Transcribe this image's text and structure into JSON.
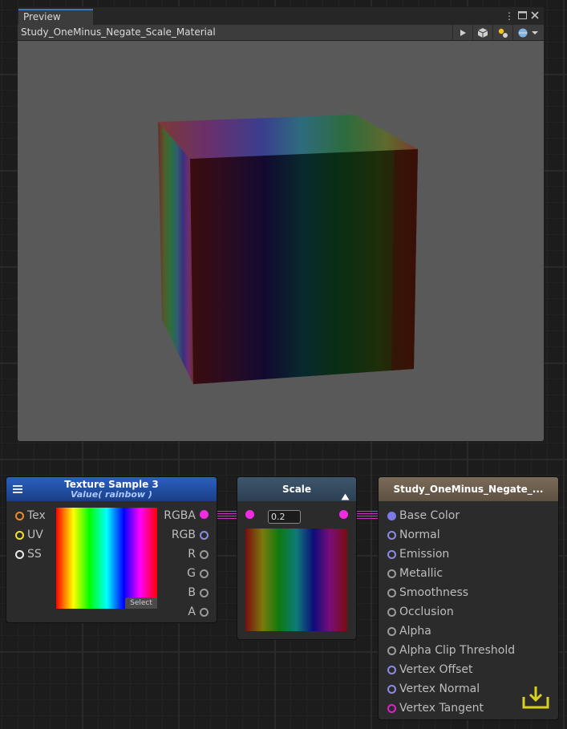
{
  "preview": {
    "tab_label": "Preview",
    "material_name": "Study_OneMinus_Negate_Scale_Material",
    "toolbar_icons": [
      "play-icon",
      "cube-mesh-icon",
      "lighting-icon",
      "sphere-icon",
      "dropdown-icon"
    ],
    "window_icons": [
      "more-options-icon",
      "maximize-icon",
      "close-icon"
    ]
  },
  "nodes": {
    "texture_sample": {
      "title": "Texture Sample 3",
      "subtitle": "Value( rainbow )",
      "inputs": [
        "Tex",
        "UV",
        "SS"
      ],
      "outputs": [
        "RGBA",
        "RGB",
        "R",
        "G",
        "B",
        "A"
      ],
      "select_label": "Select"
    },
    "scale": {
      "title": "Scale",
      "value": "0.2"
    },
    "output": {
      "title": "Study_OneMinus_Negate_...",
      "inputs": [
        "Base Color",
        "Normal",
        "Emission",
        "Metallic",
        "Smoothness",
        "Occlusion",
        "Alpha",
        "Alpha Clip Threshold",
        "Vertex Offset",
        "Vertex Normal",
        "Vertex Tangent"
      ]
    }
  },
  "colors": {
    "accent_pink": "#f02cdf",
    "tex_header": "#1f4fa8",
    "scale_header": "#354a5e",
    "output_header": "#6b5d4e",
    "output_port_blue": "#7a7ae8"
  }
}
